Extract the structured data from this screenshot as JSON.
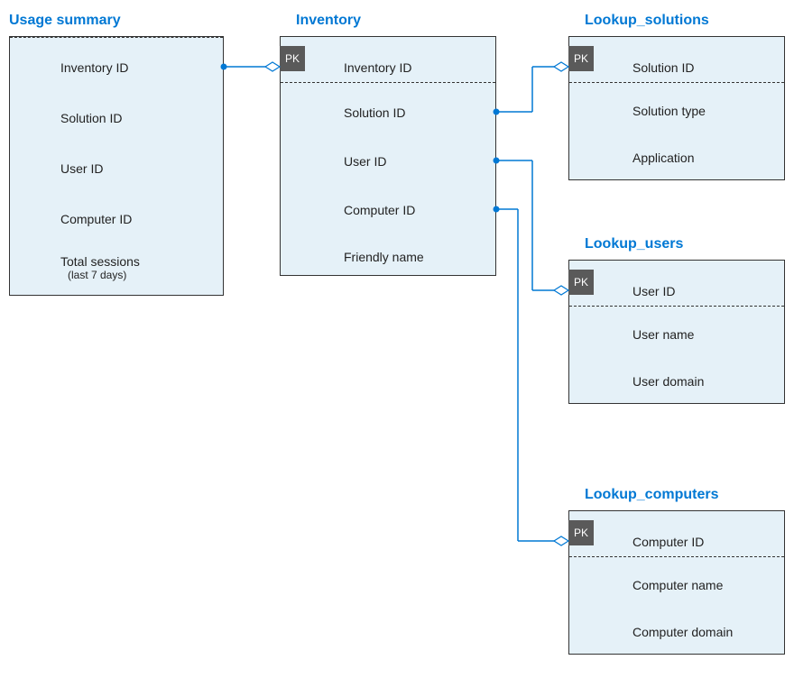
{
  "tables": {
    "usage_summary": {
      "title": "Usage summary",
      "fields": {
        "f1": "Inventory ID",
        "f2": "Solution ID",
        "f3": "User  ID",
        "f4": "Computer ID",
        "f5": "Total sessions",
        "f5_sub": "(last 7 days)"
      }
    },
    "inventory": {
      "title": "Inventory",
      "pk": "PK",
      "fields": {
        "f1": "Inventory ID",
        "f2": "Solution ID",
        "f3": "User ID",
        "f4": "Computer ID",
        "f5": "Friendly name"
      }
    },
    "lookup_solutions": {
      "title": "Lookup_solutions",
      "pk": "PK",
      "fields": {
        "f1": "Solution ID",
        "f2": "Solution type",
        "f3": "Application"
      }
    },
    "lookup_users": {
      "title": "Lookup_users",
      "pk": "PK",
      "fields": {
        "f1": "User ID",
        "f2": "User name",
        "f3": "User domain"
      }
    },
    "lookup_computers": {
      "title": "Lookup_computers",
      "pk": "PK",
      "fields": {
        "f1": "Computer ID",
        "f2": "Computer name",
        "f3": "Computer domain"
      }
    }
  }
}
